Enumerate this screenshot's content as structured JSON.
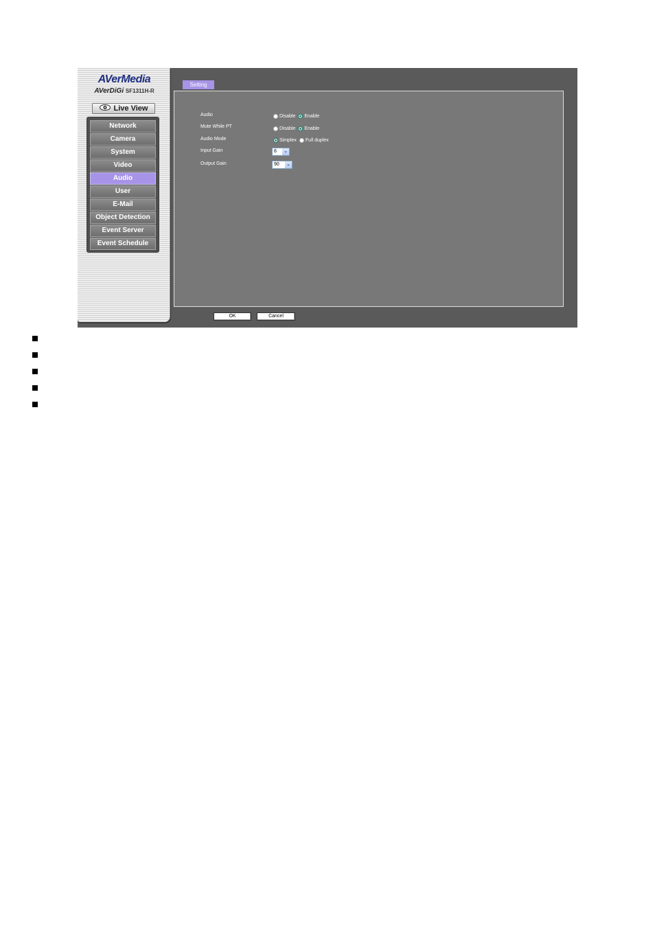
{
  "sidebar": {
    "brand": "AVerMedia",
    "model_prefix": "AVerDiGi",
    "model_name": "SF1311H-R",
    "live_view": "Live View",
    "icon": "eye-icon",
    "items": [
      {
        "label": "Network"
      },
      {
        "label": "Camera"
      },
      {
        "label": "System"
      },
      {
        "label": "Video"
      },
      {
        "label": "Audio",
        "active": true
      },
      {
        "label": "User"
      },
      {
        "label": "E-Mail"
      },
      {
        "label": "Object Detection"
      },
      {
        "label": "Event Server"
      },
      {
        "label": "Event Schedule"
      }
    ]
  },
  "main": {
    "tab": "Setting",
    "fields": {
      "audio": {
        "label": "Audio",
        "options": [
          "Disable",
          "Enable"
        ],
        "selected": "Enable"
      },
      "mute": {
        "label": "Mute While PT",
        "options": [
          "Disable",
          "Enable"
        ],
        "selected": "Enable"
      },
      "mode": {
        "label": "Audio Mode",
        "options": [
          "Simplex",
          "Full duplex"
        ],
        "selected": "Simplex"
      },
      "input_gain": {
        "label": "Input Gain",
        "value": "6"
      },
      "output_gain": {
        "label": "Output Gain",
        "value": "90"
      }
    },
    "ok_label": "OK",
    "cancel_label": "Cancel"
  },
  "colors": {
    "accent": "#a794e8",
    "frame": "#5a5a5a",
    "panel": "#787878"
  }
}
